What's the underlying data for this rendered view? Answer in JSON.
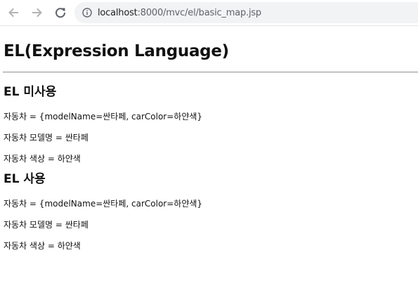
{
  "browser": {
    "url_host": "localhost",
    "url_path": ":8000/mvc/el/basic_map.jsp",
    "icons": [
      "back-arrow-icon",
      "forward-arrow-icon",
      "reload-icon",
      "info-icon"
    ]
  },
  "page": {
    "title": "EL(Expression Language)",
    "sections": [
      {
        "heading": "EL 미사용",
        "lines": [
          "자동차 = {modelName=싼타페, carColor=하얀색}",
          "자동차 모델명 = 싼타페",
          "자동차 색상 = 하얀색"
        ]
      },
      {
        "heading": "EL 사용",
        "lines": [
          "자동차 = {modelName=싼타페, carColor=하얀색}",
          "자동차 모델명 = 싼타페",
          "자동차 색상 = 하얀색"
        ]
      }
    ]
  }
}
